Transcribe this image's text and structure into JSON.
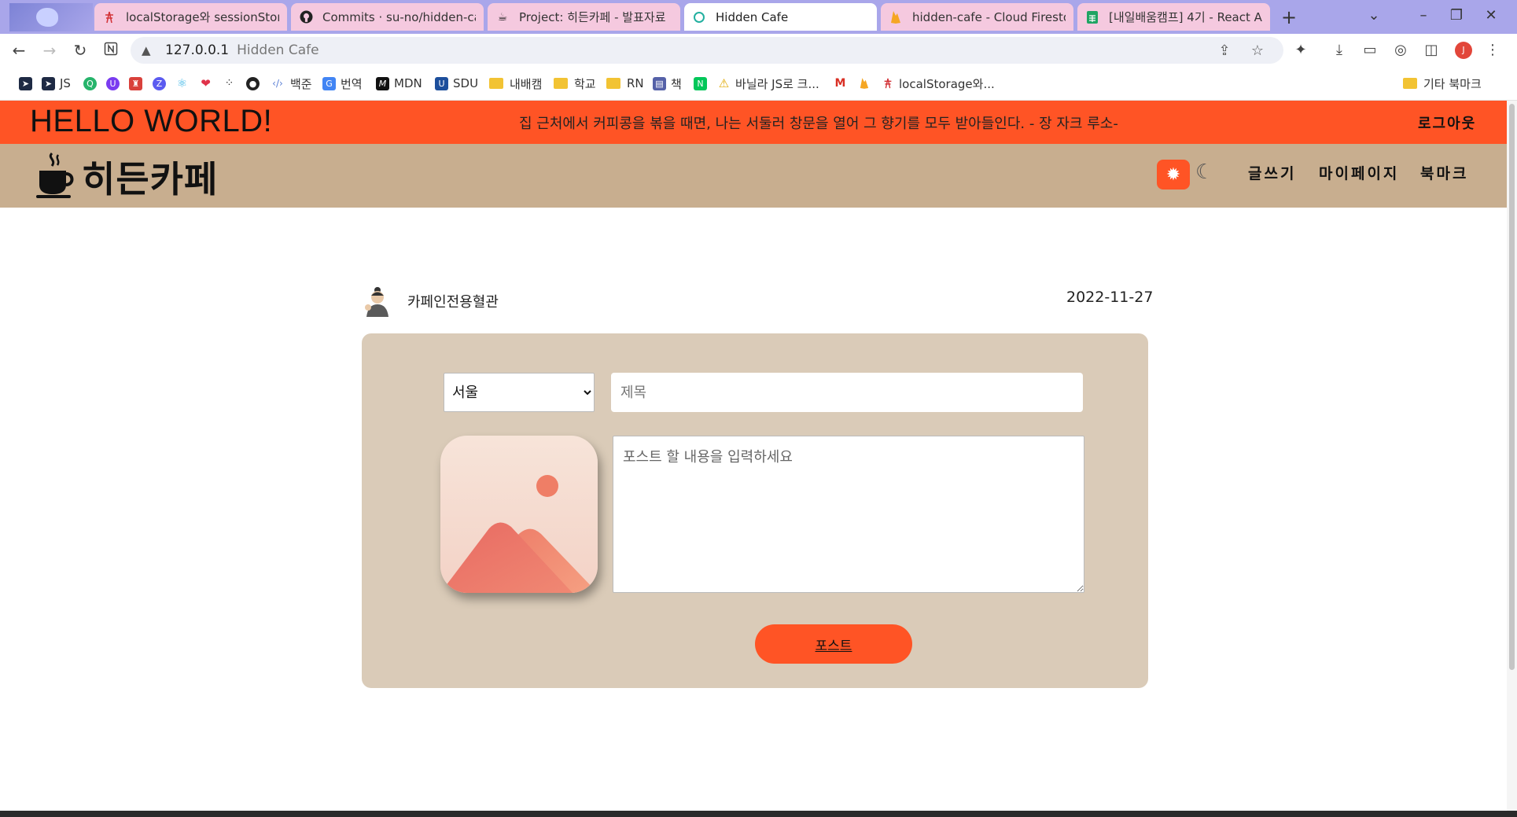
{
  "browser": {
    "tabs": [
      {
        "title": "localStorage와 sessionStorag",
        "icon": "tower-icon",
        "color": "#d3353a"
      },
      {
        "title": "Commits · su-no/hidden-cafe",
        "icon": "github-icon",
        "color": "#222222"
      },
      {
        "title": "Project: 히든카페 - 발표자료",
        "icon": "coffee-icon",
        "color": "#8a5a3c"
      },
      {
        "title": "Hidden Cafe",
        "icon": "loading-icon",
        "color": "#23b0a0",
        "active": true
      },
      {
        "title": "hidden-cafe - Cloud Firestore",
        "icon": "firebase-icon",
        "color": "#f5a623"
      },
      {
        "title": "[내일배움캠프] 4기 - React A",
        "icon": "sheets-icon",
        "color": "#1fa463"
      }
    ],
    "address": {
      "host": "127.0.0.1",
      "page_title": "Hidden Cafe"
    },
    "profile_initial": "J",
    "bookmarks": [
      {
        "label": "",
        "icon": "bookmark-app-icon",
        "color": "#1e2a44"
      },
      {
        "label": "JS",
        "icon": "js-icon",
        "color": "#1e2a44"
      },
      {
        "label": "",
        "icon": "green-app-icon",
        "color": "#26b46b"
      },
      {
        "label": "",
        "icon": "purple-app-icon",
        "color": "#7a3cf0"
      },
      {
        "label": "",
        "icon": "red-app-icon",
        "color": "#d9413b"
      },
      {
        "label": "",
        "icon": "blue-app-icon",
        "color": "#5b5bf0"
      },
      {
        "label": "",
        "icon": "react-icon",
        "color": "#38b5e6"
      },
      {
        "label": "",
        "icon": "heart-app-icon",
        "color": "#e0334a"
      },
      {
        "label": "",
        "icon": "dots-icon",
        "color": "#333333"
      },
      {
        "label": "",
        "icon": "github-icon",
        "color": "#222222"
      },
      {
        "label": "백준",
        "icon": "code-icon",
        "color": "#5a7fd6"
      },
      {
        "label": "번역",
        "icon": "translate-icon",
        "color": "#4285f4"
      },
      {
        "label": "MDN",
        "icon": "mdn-icon",
        "color": "#111111"
      },
      {
        "label": "SDU",
        "icon": "sdu-icon",
        "color": "#1d4f9c"
      },
      {
        "label": "내배캠",
        "icon": "folder-icon",
        "color": "#f2c333"
      },
      {
        "label": "학교",
        "icon": "folder-icon",
        "color": "#f2c333"
      },
      {
        "label": "RN",
        "icon": "folder-icon",
        "color": "#f2c333"
      },
      {
        "label": "책",
        "icon": "book-icon",
        "color": "#5561a8"
      },
      {
        "label": "",
        "icon": "naver-icon",
        "color": "#03c75a"
      },
      {
        "label": "바닐라 JS로 크...",
        "icon": "warning-icon",
        "color": "#e0a800"
      },
      {
        "label": "",
        "icon": "gmail-icon",
        "color": "#d93025"
      },
      {
        "label": "",
        "icon": "firebase-icon",
        "color": "#f5a623"
      },
      {
        "label": "localStorage와...",
        "icon": "tower-icon",
        "color": "#d3353a"
      }
    ],
    "other_bookmarks": "기타 북마크"
  },
  "header": {
    "hello": "HELLO WORLD!",
    "quote": "집 근처에서 커피콩을 볶을 때면, 나는 서둘러 창문을 열어 그 향기를 모두 받아들인다. - 장 자크 루소-",
    "logout": "로그아웃"
  },
  "nav": {
    "logo_text": "히든카페",
    "links": [
      "글쓰기",
      "마이페이지",
      "북마크"
    ]
  },
  "post": {
    "author": "카페인전용혈관",
    "date": "2022-11-27",
    "region": "서울",
    "title_placeholder": "제목",
    "content_placeholder": "포스트 할 내용을 입력하세요",
    "submit_label": "포스트"
  },
  "colors": {
    "accent": "#ff5425",
    "nav_bg": "#c8ae8f",
    "card_bg": "#dacbb8"
  }
}
